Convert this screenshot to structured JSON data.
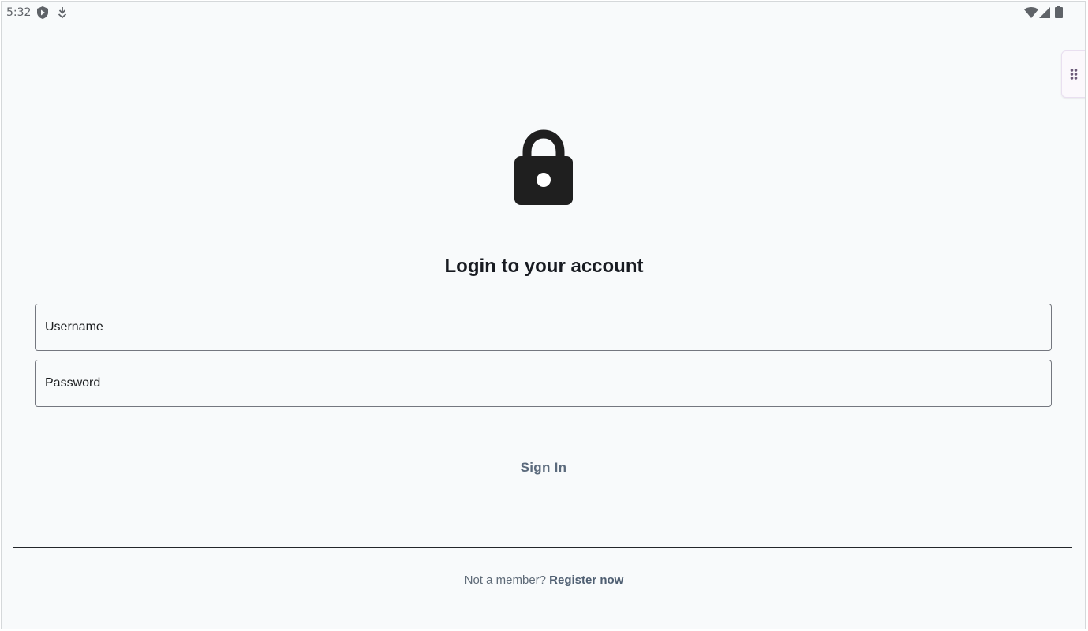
{
  "status_bar": {
    "time": "5:32",
    "left_icons": [
      "shield-play-icon",
      "download-arrow-icon"
    ],
    "right_icons": [
      "wifi-icon",
      "cellular-signal-icon",
      "battery-icon"
    ]
  },
  "side_handle": {
    "icon": "drag-dots-icon"
  },
  "header": {
    "icon": "lock-icon",
    "title": "Login to your account"
  },
  "form": {
    "username": {
      "placeholder": "Username",
      "value": ""
    },
    "password": {
      "placeholder": "Password",
      "value": ""
    },
    "sign_in_label": "Sign In"
  },
  "footer": {
    "prompt": "Not a member?",
    "register_label": "Register now"
  },
  "colors": {
    "background": "#f8fafb",
    "title_text": "#181b21",
    "field_border": "#74777f",
    "button_text": "#5b6a7c",
    "link_text": "#4f5f72"
  }
}
